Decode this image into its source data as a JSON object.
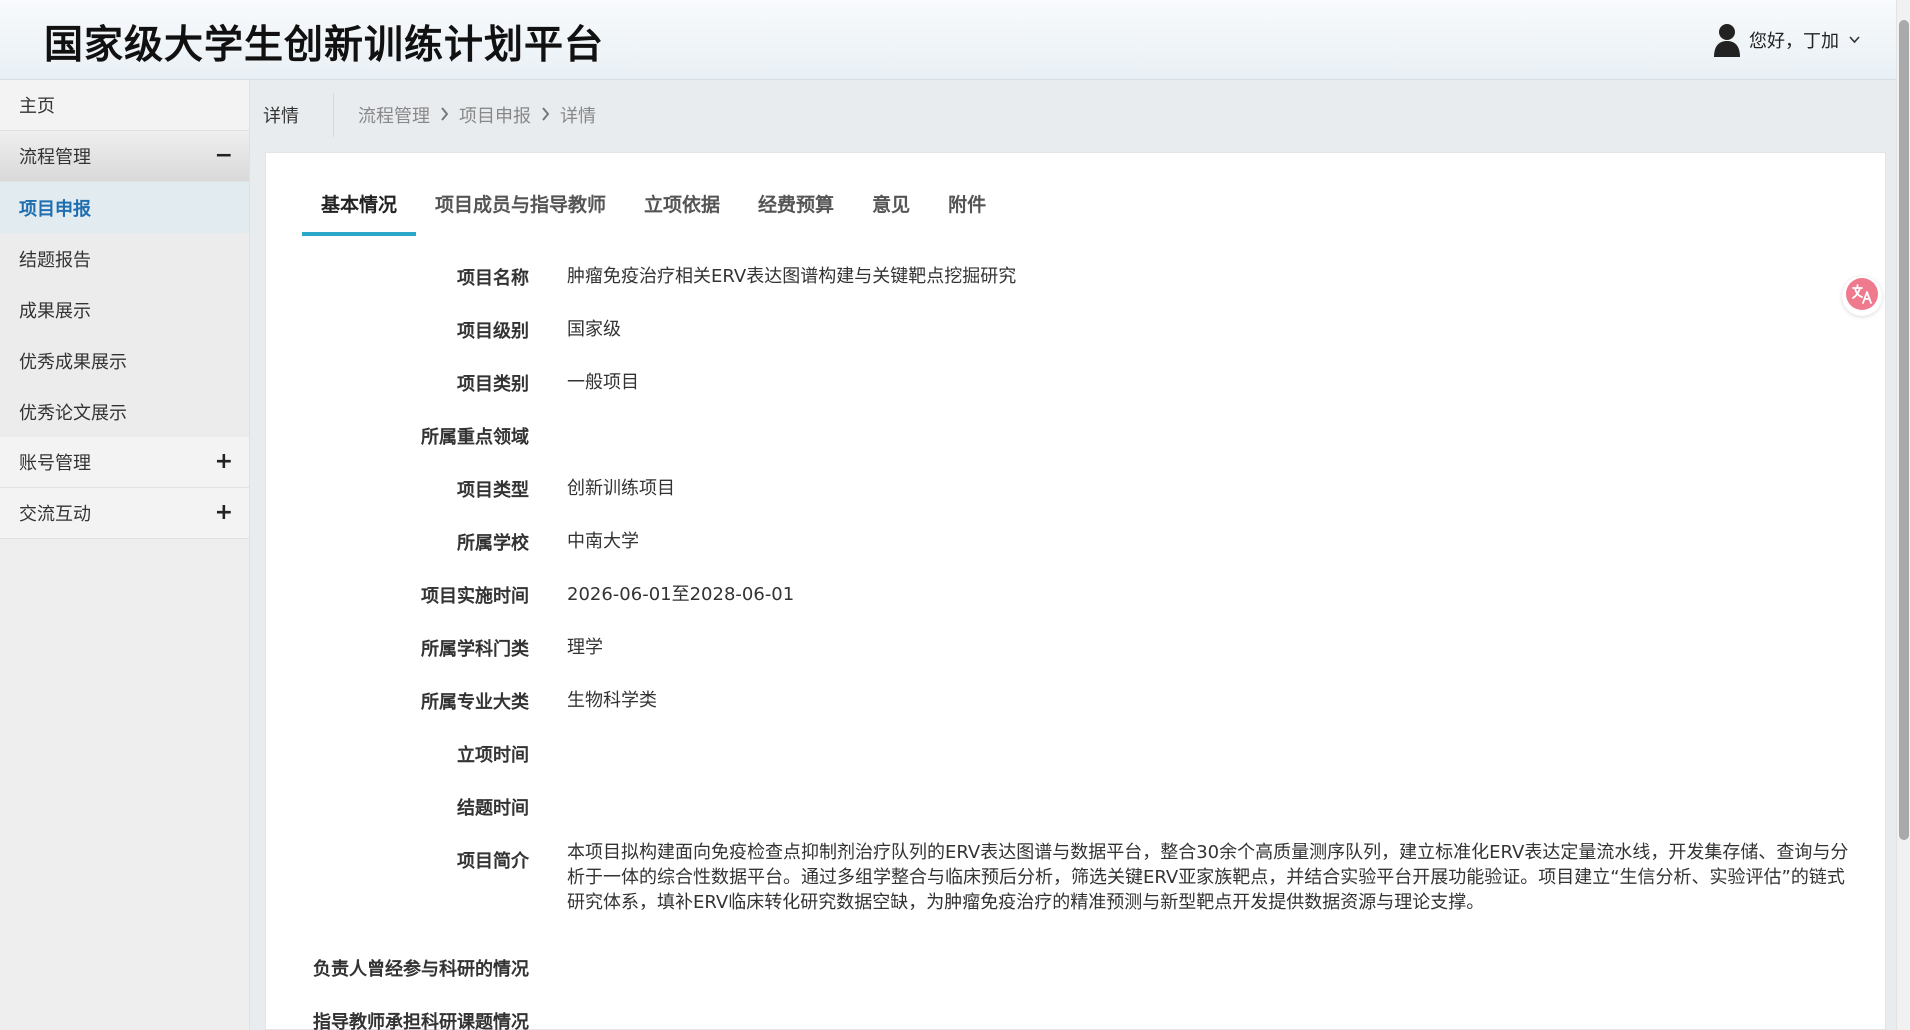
{
  "header": {
    "title": "国家级大学生创新训练计划平台",
    "greeting": "您好，丁加"
  },
  "sidebar": {
    "items": [
      {
        "label": "主页",
        "type": "item"
      },
      {
        "label": "流程管理",
        "type": "group",
        "sign": "−",
        "children": [
          {
            "label": "项目申报",
            "active": true
          },
          {
            "label": "结题报告",
            "active": false
          },
          {
            "label": "成果展示",
            "active": false
          },
          {
            "label": "优秀成果展示",
            "active": false
          },
          {
            "label": "优秀论文展示",
            "active": false
          }
        ]
      },
      {
        "label": "账号管理",
        "type": "group",
        "sign": "+"
      },
      {
        "label": "交流互动",
        "type": "group",
        "sign": "+"
      }
    ]
  },
  "breadcrumb": {
    "current": "详情",
    "path": [
      "流程管理",
      "项目申报",
      "详情"
    ]
  },
  "tabs": [
    {
      "label": "基本情况",
      "active": true
    },
    {
      "label": "项目成员与指导教师",
      "active": false
    },
    {
      "label": "立项依据",
      "active": false
    },
    {
      "label": "经费预算",
      "active": false
    },
    {
      "label": "意见",
      "active": false
    },
    {
      "label": "附件",
      "active": false
    }
  ],
  "fields": [
    {
      "label": "项目名称",
      "value": "肿瘤免疫治疗相关ERV表达图谱构建与关键靶点挖掘研究"
    },
    {
      "label": "项目级别",
      "value": "国家级"
    },
    {
      "label": "项目类别",
      "value": "一般项目"
    },
    {
      "label": "所属重点领域",
      "value": ""
    },
    {
      "label": "项目类型",
      "value": "创新训练项目"
    },
    {
      "label": "所属学校",
      "value": "中南大学"
    },
    {
      "label": "项目实施时间",
      "value": "2026-06-01至2028-06-01"
    },
    {
      "label": "所属学科门类",
      "value": "理学"
    },
    {
      "label": "所属专业大类",
      "value": "生物科学类"
    },
    {
      "label": "立项时间",
      "value": ""
    },
    {
      "label": "结题时间",
      "value": ""
    },
    {
      "label": "项目简介",
      "value": "本项目拟构建面向免疫检查点抑制剂治疗队列的ERV表达图谱与数据平台，整合30余个高质量测序队列，建立标准化ERV表达定量流水线，开发集存储、查询与分析于一体的综合性数据平台。通过多组学整合与临床预后分析，筛选关键ERV亚家族靶点，并结合实验平台开展功能验证。项目建立“生信分析、实验评估”的链式研究体系，填补ERV临床转化研究数据空缺，为肿瘤免疫治疗的精准预测与新型靶点开发提供数据资源与理论支撑。",
      "multi": true
    },
    {
      "label": "负责人曾经参与科研的情况",
      "value": ""
    },
    {
      "label": "指导教师承担科研课题情况",
      "value": ""
    }
  ],
  "colors": {
    "accent": "#2aa7c9",
    "active_nav_text": "#1f6fb0",
    "translate_icon": "#f07a8d"
  },
  "icons": {
    "user": "user-avatar-icon",
    "dropdown": "chevron-down-icon",
    "crumb_sep": "chevron-right-icon",
    "translate": "translate-icon"
  }
}
